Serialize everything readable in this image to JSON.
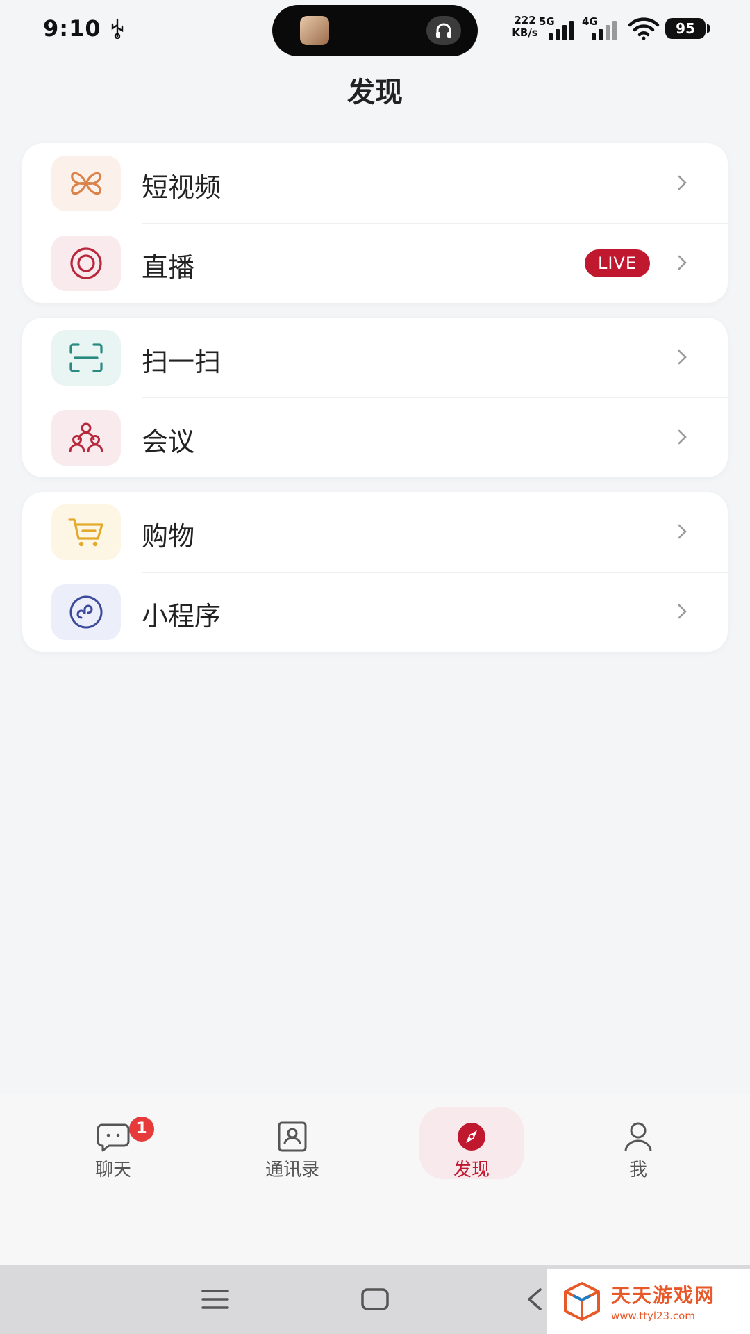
{
  "status_bar": {
    "time": "9:10",
    "net_speed_value": "222",
    "net_speed_unit": "KB/s",
    "signal_1": "5G",
    "signal_2": "4G",
    "battery": "95"
  },
  "header": {
    "title": "发现"
  },
  "groups": [
    {
      "items": [
        {
          "label": "短视频",
          "icon": "butterfly-icon",
          "icon_color": "#d9834a",
          "icon_bg": "#fcf1ea"
        },
        {
          "label": "直播",
          "icon": "live-circle-icon",
          "icon_color": "#b8283c",
          "icon_bg": "#f8eaed",
          "badge": "LIVE"
        }
      ]
    },
    {
      "items": [
        {
          "label": "扫一扫",
          "icon": "scan-icon",
          "icon_color": "#2a8a82",
          "icon_bg": "#e8f5f3"
        },
        {
          "label": "会议",
          "icon": "meeting-icon",
          "icon_color": "#b8283c",
          "icon_bg": "#f8eaed"
        }
      ]
    },
    {
      "items": [
        {
          "label": "购物",
          "icon": "cart-icon",
          "icon_color": "#e4a92a",
          "icon_bg": "#fdf6e4"
        },
        {
          "label": "小程序",
          "icon": "mini-program-icon",
          "icon_color": "#3b4a9a",
          "icon_bg": "#eceef9"
        }
      ]
    }
  ],
  "tab_bar": {
    "tabs": [
      {
        "label": "聊天",
        "icon": "chat-icon",
        "badge": "1"
      },
      {
        "label": "通讯录",
        "icon": "contacts-icon"
      },
      {
        "label": "发现",
        "icon": "compass-icon",
        "active": true
      },
      {
        "label": "我",
        "icon": "person-icon"
      }
    ]
  },
  "colors": {
    "accent": "#c0182e",
    "background": "#f4f5f7"
  },
  "watermark": {
    "title": "天天游戏网",
    "url": "www.ttyl23.com"
  }
}
